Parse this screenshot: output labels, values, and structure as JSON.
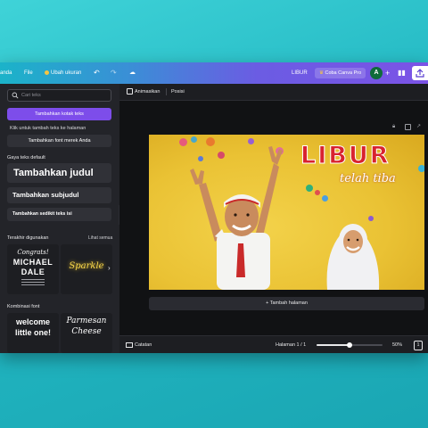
{
  "topbar": {
    "menu_partial": "anda",
    "file": "File",
    "resize": "Ubah ukuran",
    "doc_title": "LIBUR",
    "try_pro": "Coba Canva Pro",
    "avatar_initial": "A",
    "accent": "#7b53e6"
  },
  "panel": {
    "search_placeholder": "Cari teks",
    "add_textbox": "Tambahkan kotak teks",
    "click_hint": "Klik untuk tambah teks ke halaman",
    "brand_fonts": "Tambahkan font merek Anda",
    "default_styles": "Gaya teks default",
    "heading": "Tambahkan judul",
    "subheading": "Tambahkan subjudul",
    "body": "Tambahkan sedikit teks isi",
    "recent": "Terakhir digunakan",
    "see_all": "Lihat semua",
    "recent_items": [
      {
        "line1": "Congrats!",
        "line2": "MICHAEL",
        "line3": "DALE"
      },
      {
        "line1": "Sparkle"
      }
    ],
    "combos": "Kombinasi font",
    "combo_items": [
      {
        "line1": "welcome",
        "line2": "little one!"
      },
      {
        "line1": "Parmesan",
        "line2": "Cheese"
      }
    ]
  },
  "toolbar": {
    "animate": "Animasikan",
    "position": "Posisi"
  },
  "slide": {
    "title": "LIBUR",
    "subtitle": "telah tiba"
  },
  "canvas": {
    "add_page": "+ Tambah halaman"
  },
  "bottombar": {
    "notes": "Catatan",
    "page_indicator": "Halaman 1 / 1",
    "zoom": "50%",
    "zoom_fraction": 0.5,
    "page_count": "1"
  }
}
